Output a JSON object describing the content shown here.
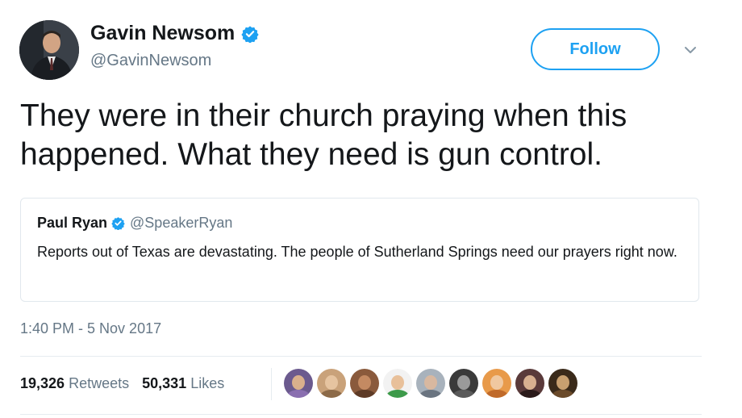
{
  "tweet": {
    "author": {
      "name": "Gavin Newsom",
      "handle": "@GavinNewsom",
      "verified": true,
      "avatar_icon": "person-in-suit-avatar"
    },
    "follow_label": "Follow",
    "text": "They were in their church praying when this\nhappened. What they need is gun control.",
    "quoted": {
      "name": "Paul Ryan",
      "handle": "@SpeakerRyan",
      "verified": true,
      "text": "Reports out of Texas are devastating. The people of Sutherland Springs need our prayers right now."
    },
    "timestamp": "1:40 PM - 5 Nov 2017",
    "stats": {
      "retweets_count": "19,326",
      "retweets_label": "Retweets",
      "likes_count": "50,331",
      "likes_label": "Likes"
    },
    "likers": [
      {
        "bg": "#6b5a8e",
        "face": "#d9b08c",
        "body": "#8a6fb0"
      },
      {
        "bg": "#c9a27a",
        "face": "#e6c4a0",
        "body": "#8c6a48"
      },
      {
        "bg": "#8a5a3c",
        "face": "#c48a62",
        "body": "#5e3b26"
      },
      {
        "bg": "#f2f2f2",
        "face": "#e8c09a",
        "body": "#3d9a4a"
      },
      {
        "bg": "#a8b2bc",
        "face": "#d8b8a0",
        "body": "#6a7480"
      },
      {
        "bg": "#3a3a3a",
        "face": "#9a9a9a",
        "body": "#5a5a5a"
      },
      {
        "bg": "#e89a4a",
        "face": "#f0c8a0",
        "body": "#c06a2a"
      },
      {
        "bg": "#5a3a3a",
        "face": "#d8b090",
        "body": "#2a1a1a"
      },
      {
        "bg": "#3a2a1a",
        "face": "#c8a070",
        "body": "#6a4a2a"
      }
    ],
    "colors": {
      "brand_blue": "#1da1f2",
      "secondary_text": "#657786",
      "primary_text": "#14171a"
    }
  }
}
